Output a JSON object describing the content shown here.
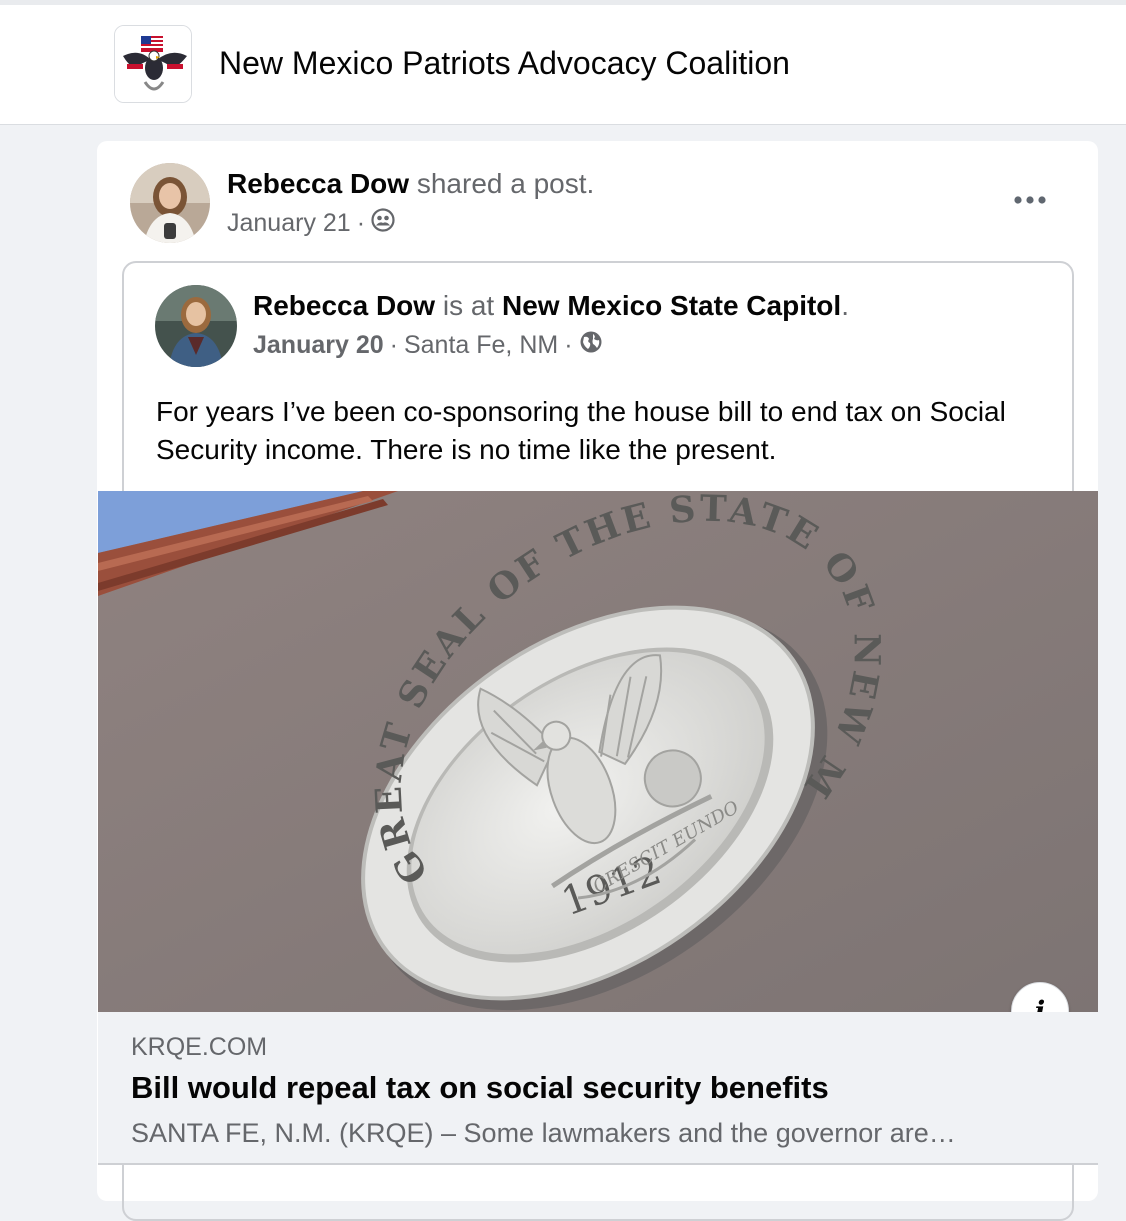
{
  "header": {
    "page_name": "New Mexico Patriots Advocacy Coalition",
    "logo_icon": "eagle-flag-logo-icon"
  },
  "post": {
    "author": "Rebecca Dow",
    "action": "shared a post.",
    "date": "January 21",
    "separator": "·",
    "audience_icon": "friends-icon",
    "more_icon": "more-options-icon"
  },
  "shared_post": {
    "author": "Rebecca Dow",
    "is_at": "is at",
    "place": "New Mexico State Capitol",
    "period": ".",
    "date": "January 20",
    "location": "Santa Fe, NM",
    "separator": "·",
    "audience_icon": "globe-icon",
    "text": "For years I’ve been co-sponsoring the house bill to end tax on Social Security income. There is no time like the present."
  },
  "link": {
    "image_icon": "state-seal-photo",
    "seal_text": "GREAT SEAL OF THE STATE OF NEW MEXICO",
    "seal_year": "1912",
    "seal_motto": "CRESCIT EUNDO",
    "info_label": "i",
    "domain": "KRQE.COM",
    "title": "Bill would repeal tax on social security benefits",
    "description": "SANTA FE, N.M. (KRQE) – Some lawmakers and the governor are…"
  }
}
